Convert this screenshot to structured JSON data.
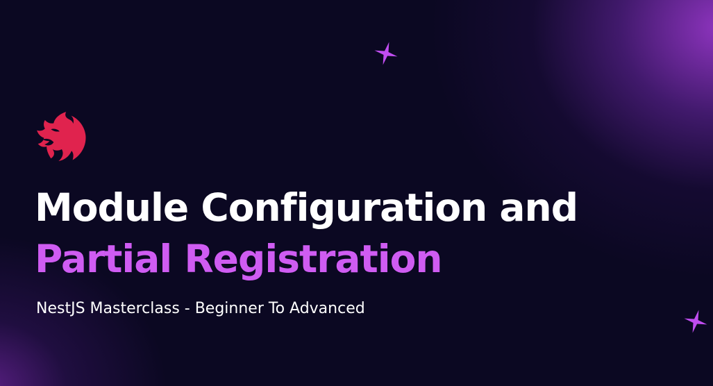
{
  "slide": {
    "title_line_1": "Module Configuration and",
    "title_line_2": "Partial Registration",
    "subtitle": "NestJS Masterclass - Beginner To Advanced"
  },
  "icons": {
    "logo": "nestjs-logo-icon",
    "sparkle_top": "sparkle-icon",
    "sparkle_bottom_right": "sparkle-icon"
  },
  "colors": {
    "background": "#0b0822",
    "accent_purple": "#cf5cf2",
    "logo_red": "#e0234e",
    "title_white": "#ffffff",
    "sparkle": "#c04df0"
  }
}
